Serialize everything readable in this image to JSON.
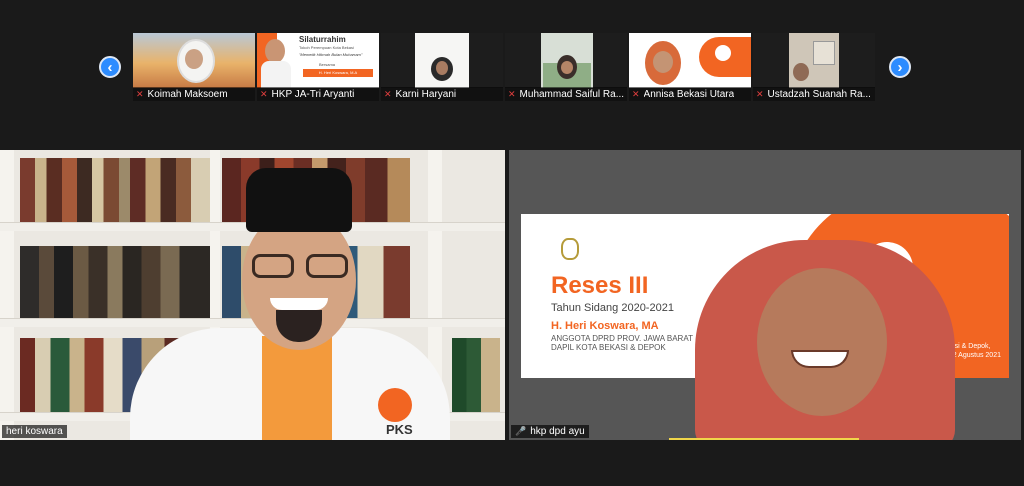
{
  "thumbnails": [
    {
      "name": "Koimah Maksoem"
    },
    {
      "name": "HKP JA-Tri Aryanti",
      "poster_title": "Silaturrahim",
      "poster_sub": "Tokoh Perempuan Kota Bekasi",
      "poster_quote": "\"Memetik Hikmah Bulan Muharram\"",
      "poster_with": "Bersama",
      "poster_speaker": "H. Heri Koswara, M.A"
    },
    {
      "name": "Karni Haryani"
    },
    {
      "name": "Muhammad Saiful Ra..."
    },
    {
      "name": "Annisa Bekasi Utara"
    },
    {
      "name": "Ustadzah Suanah Ra..."
    }
  ],
  "nav": {
    "prev_icon": "chevron-left-icon",
    "next_icon": "chevron-right-icon",
    "prev_glyph": "‹",
    "next_glyph": "›"
  },
  "main": {
    "left_name": "heri koswara",
    "right_name": "hkp dpd ayu",
    "slide": {
      "title": "Reses III",
      "subtitle": "Tahun Sidang 2020-2021",
      "speaker": "H. Heri Koswara, MA",
      "desc_1": "ANGGOTA DPRD PROV. JAWA BARAT",
      "desc_2": "DAPIL KOTA BEKASI & DEPOK",
      "place_1": "Bekasi & Depok,",
      "place_2": "2 - 12 Agustus 2021",
      "logo": "PKS"
    },
    "jacket_logo": "PKS"
  },
  "colors": {
    "accent": "#2d8cff",
    "pks_orange": "#f26522",
    "muted_mic": "#e03e3e"
  }
}
